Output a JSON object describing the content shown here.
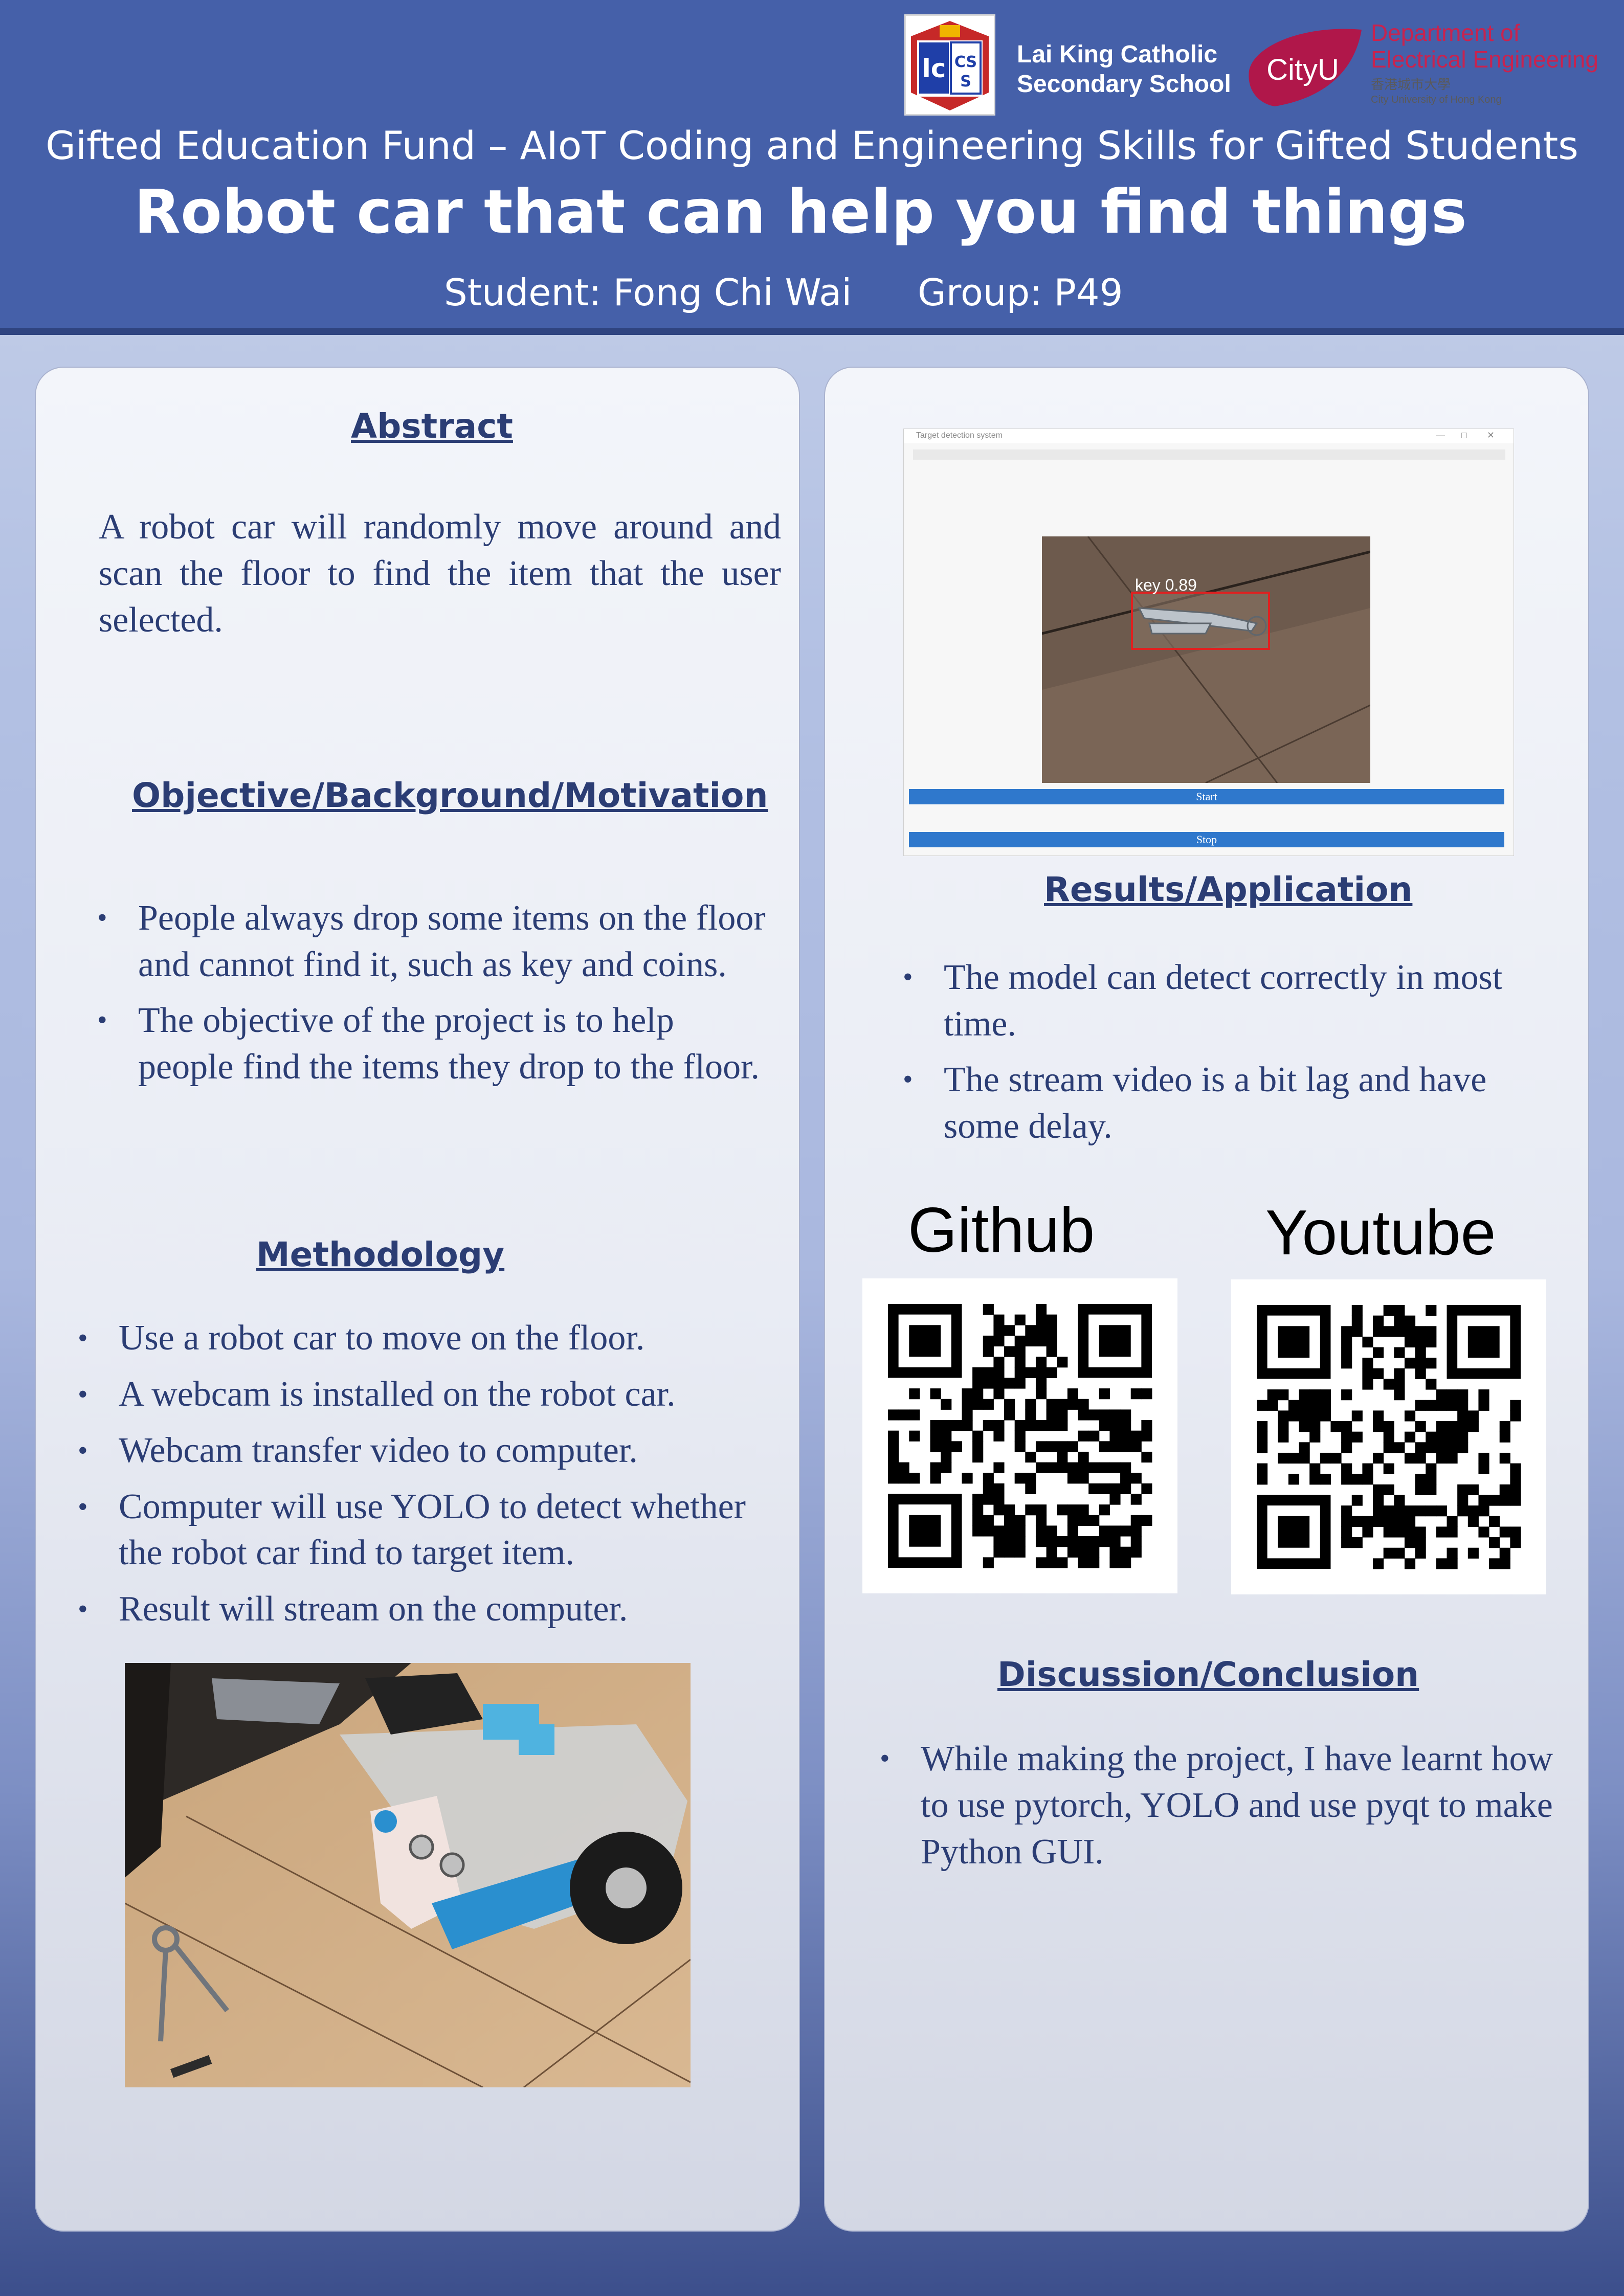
{
  "header": {
    "school_logo_text": "LKCSS",
    "school_name_line1": "Lai King Catholic",
    "school_name_line2": "Secondary School",
    "cityu_logo_text": "CityU",
    "dept_line1": "Department of",
    "dept_line2": "Electrical Engineering",
    "uni_chinese": "香港城市大學",
    "uni_english": "City University of Hong Kong",
    "fund_line": "Gifted Education Fund – AIoT Coding and Engineering Skills for Gifted Students",
    "title": "Robot car that can help you find things",
    "student": "Student:  Fong Chi Wai",
    "group": "Group: P49"
  },
  "abstract": {
    "heading": "Abstract",
    "text": "A robot car will randomly move around and scan the floor to find the item that the user selected."
  },
  "objective": {
    "heading": "Objective/Background/Motivation",
    "bullets": [
      "People always drop some items on the floor and cannot find it, such as key and coins.",
      "The objective of the project is to help people find the items they drop to the floor."
    ]
  },
  "methodology": {
    "heading": "Methodology",
    "bullets": [
      "Use a robot car to move on the floor.",
      "A webcam is installed on the robot car.",
      "Webcam transfer video to computer.",
      "Computer will use YOLO to detect whether the robot car find to target item.",
      "Result will stream on the computer."
    ]
  },
  "gui": {
    "window_title": "Target detection system",
    "detection_label": "key  0.89",
    "start_button": "Start",
    "stop_button": "Stop"
  },
  "results": {
    "heading": "Results/Application",
    "bullets": [
      "The model can detect correctly in most time.",
      "The stream video is a bit lag and have some delay."
    ]
  },
  "qr": {
    "github_label": "Github",
    "youtube_label": "Youtube"
  },
  "discussion": {
    "heading": "Discussion/Conclusion",
    "bullets": [
      "While making the project, I have learnt how to use pytorch, YOLO and use pyqt to make Python GUI."
    ]
  },
  "colors": {
    "header_bg": "#4560a9",
    "heading_text": "#2b3d74",
    "logo_red": "#c8234f",
    "button_blue": "#2f78cc",
    "detection_box": "#e02020"
  }
}
